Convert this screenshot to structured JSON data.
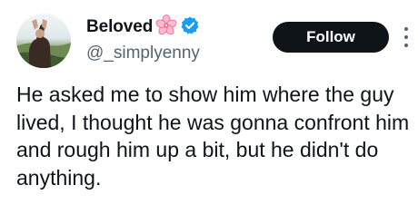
{
  "user": {
    "display_name": "Beloved",
    "handle": "@_simplyenny",
    "verified": true,
    "emoji": "cherry-blossom-icon"
  },
  "actions": {
    "follow_label": "Follow",
    "more_icon": "more-vertical-icon"
  },
  "tweet": {
    "text": "He asked me to show him where the guy lived, I thought he was gonna confront him and rough him up a bit, but he didn't do anything."
  },
  "colors": {
    "verified_blue": "#1d9bf0",
    "blossom_pink": "#f48fb1",
    "follow_bg": "#0f1419",
    "secondary_text": "#536471"
  }
}
